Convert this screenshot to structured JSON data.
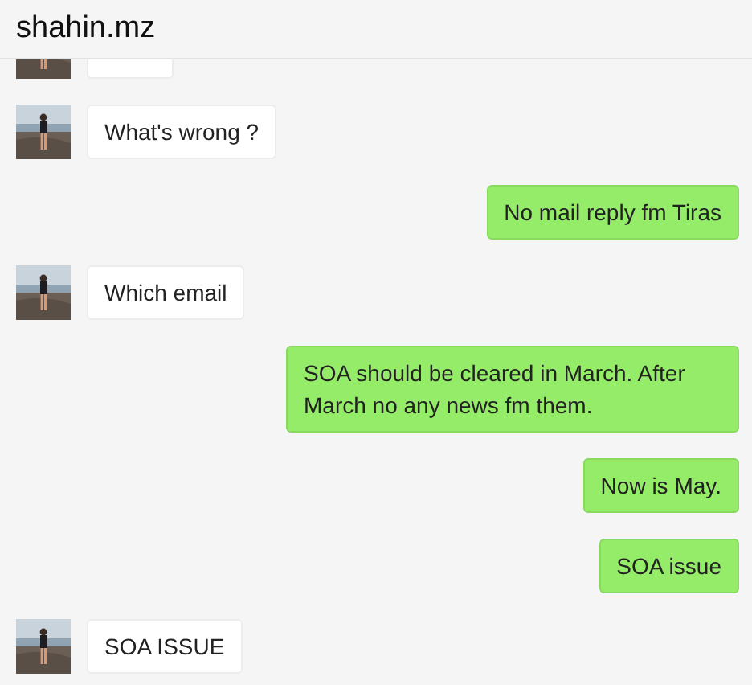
{
  "window": {
    "title": "shahin.mz"
  },
  "messages": [
    {
      "outgoing": false,
      "kind": "partial"
    },
    {
      "outgoing": false,
      "kind": "text",
      "text": "What's wrong ?"
    },
    {
      "outgoing": true,
      "kind": "text",
      "text": "No mail reply fm Tiras"
    },
    {
      "outgoing": false,
      "kind": "text",
      "text": "Which email"
    },
    {
      "outgoing": true,
      "kind": "text",
      "text": "SOA should be cleared in March. After March no any news fm them."
    },
    {
      "outgoing": true,
      "kind": "text",
      "text": "Now is May."
    },
    {
      "outgoing": true,
      "kind": "text",
      "text": "SOA issue"
    },
    {
      "outgoing": false,
      "kind": "text",
      "text": "SOA ISSUE"
    }
  ]
}
